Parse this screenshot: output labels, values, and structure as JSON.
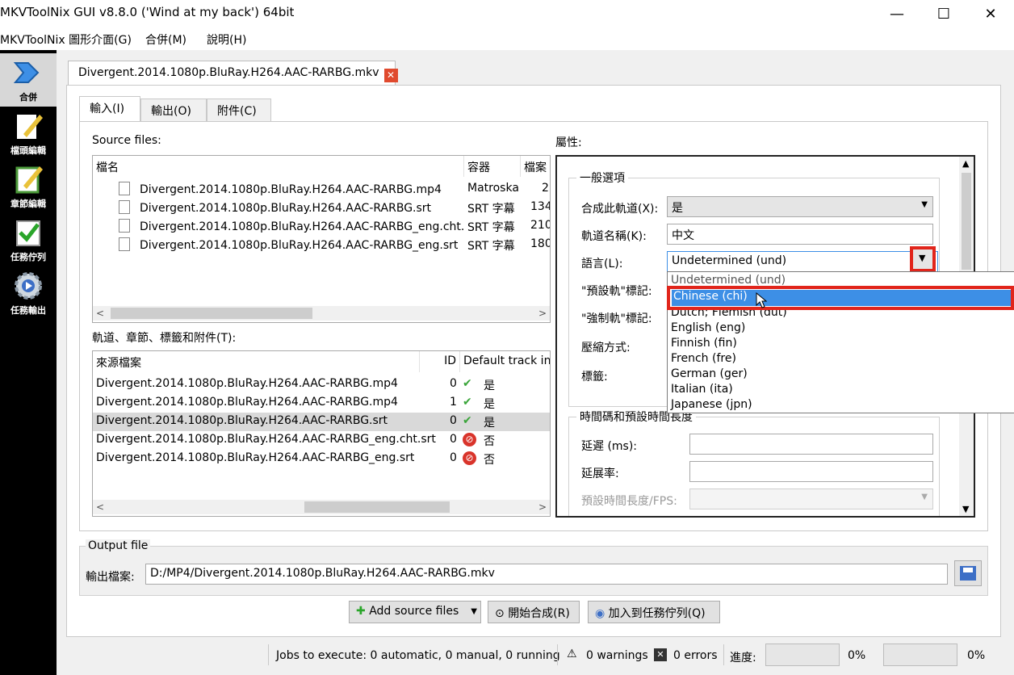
{
  "window": {
    "title": "MKVToolNix GUI v8.8.0 ('Wind at my back') 64bit",
    "controls": {
      "minimize": "—",
      "maximize": "☐",
      "close": "✕"
    }
  },
  "menu": [
    "MKVToolNix 圖形介面(G)",
    "合併(M)",
    "說明(H)"
  ],
  "sidebar": {
    "items": [
      {
        "label": "合併",
        "icon": "merge-arrow-icon",
        "active": true
      },
      {
        "label": "檔頭編輯",
        "icon": "header-editor-icon"
      },
      {
        "label": "章節編輯",
        "icon": "chapter-editor-icon"
      },
      {
        "label": "任務佇列",
        "icon": "job-queue-icon"
      },
      {
        "label": "任務輸出",
        "icon": "job-output-icon"
      }
    ]
  },
  "file_tab": {
    "label": "Divergent.2014.1080p.BluRay.H264.AAC-RARBG.mkv",
    "close": "✕"
  },
  "subtabs": [
    "輸入(I)",
    "輸出(O)",
    "附件(C)"
  ],
  "source_files": {
    "label": "Source files:",
    "columns": [
      "檔名",
      "容器",
      "檔案"
    ],
    "rows": [
      {
        "name": "Divergent.2014.1080p.BluRay.H264.AAC-RARBG.mp4",
        "container": "Matroska",
        "size": "2"
      },
      {
        "name": "Divergent.2014.1080p.BluRay.H264.AAC-RARBG.srt",
        "container": "SRT 字幕",
        "size": "134"
      },
      {
        "name": "Divergent.2014.1080p.BluRay.H264.AAC-RARBG_eng.cht.srt",
        "container": "SRT 字幕",
        "size": "210"
      },
      {
        "name": "Divergent.2014.1080p.BluRay.H264.AAC-RARBG_eng.srt",
        "container": "SRT 字幕",
        "size": "180"
      }
    ]
  },
  "tracks": {
    "label": "軌道、章節、標籤和附件(T):",
    "columns": [
      "來源檔案",
      "ID",
      "Default track in"
    ],
    "rows": [
      {
        "source": "Divergent.2014.1080p.BluRay.H264.AAC-RARBG.mp4",
        "id": "0",
        "default": "是",
        "ok": true
      },
      {
        "source": "Divergent.2014.1080p.BluRay.H264.AAC-RARBG.mp4",
        "id": "1",
        "default": "是",
        "ok": true
      },
      {
        "source": "Divergent.2014.1080p.BluRay.H264.AAC-RARBG.srt",
        "id": "0",
        "default": "是",
        "ok": true,
        "selected": true
      },
      {
        "source": "Divergent.2014.1080p.BluRay.H264.AAC-RARBG_eng.cht.srt",
        "id": "0",
        "default": "否",
        "ok": false
      },
      {
        "source": "Divergent.2014.1080p.BluRay.H264.AAC-RARBG_eng.srt",
        "id": "0",
        "default": "否",
        "ok": false
      }
    ]
  },
  "properties": {
    "label": "屬性:",
    "general_group": "一般選項",
    "merge_track_label": "合成此軌道(X):",
    "merge_track_value": "是",
    "track_name_label": "軌道名稱(K):",
    "track_name_value": "中文",
    "language_label": "語言(L):",
    "language_value": "Undetermined (und)",
    "default_flag_label": "\"預設軌\"標記:",
    "forced_flag_label": "\"強制軌\"標記:",
    "compression_label": "壓縮方式:",
    "tags_label": "標籤:",
    "timecode_group": "時間碼和預設時間長度",
    "delay_label": "延遲 (ms):",
    "stretch_label": "延展率:",
    "fps_label": "預設時間長度/FPS:"
  },
  "language_dropdown": {
    "options": [
      "Undetermined (und)",
      "Chinese (chi)",
      "Dutch; Flemish (dut)",
      "English (eng)",
      "Finnish (fin)",
      "French (fre)",
      "German (ger)",
      "Italian (ita)",
      "Japanese (jpn)"
    ],
    "selected_index": 1
  },
  "output": {
    "group_label": "Output file",
    "field_label": "輸出檔案:",
    "path": "D:/MP4/Divergent.2014.1080p.BluRay.H264.AAC-RARBG.mkv"
  },
  "actions": {
    "add_source": "Add source files",
    "start_merge": "開始合成(R)",
    "add_to_queue": "加入到任務佇列(Q)"
  },
  "status": {
    "jobs": "Jobs to execute:  0 automatic, 0 manual, 0 running",
    "warnings": "0 warnings",
    "errors": "0 errors",
    "progress_label": "進度:",
    "progress_1": "0%",
    "progress_2": "0%"
  },
  "colors": {
    "highlight": "#3d8fe6",
    "annotation": "#e1251b",
    "sidebar": "#000000"
  }
}
